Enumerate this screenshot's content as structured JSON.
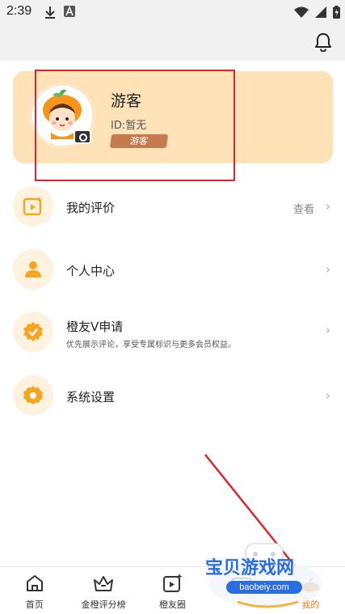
{
  "status_bar": {
    "time": "2:39"
  },
  "profile": {
    "name": "游客",
    "id_text": "ID:暂无",
    "badge": "游客"
  },
  "menu": {
    "items": [
      {
        "label": "我的评价",
        "action": "查看",
        "icon": "review-icon"
      },
      {
        "label": "个人中心",
        "icon": "person-icon"
      },
      {
        "label": "橙友V申请",
        "subtitle": "优先展示评论，享受专属标识与更多会员权益。",
        "icon": "verified-badge-icon"
      },
      {
        "label": "系统设置",
        "icon": "settings-gear-icon"
      }
    ],
    "chevron": "›"
  },
  "bottom_nav": {
    "items": [
      {
        "label": "首页",
        "icon": "home-icon"
      },
      {
        "label": "金橙评分榜",
        "icon": "crown-icon"
      },
      {
        "label": "橙友圈",
        "icon": "post-video-icon"
      },
      {
        "label": "",
        "icon": "game-controller-icon"
      },
      {
        "label": "我的",
        "icon": "profile-orange-icon",
        "active": true
      }
    ]
  },
  "watermark": {
    "title": "宝贝游戏网",
    "url": "baobeiy.com"
  },
  "colors": {
    "accent": "#e57b18",
    "card_bg": "#ffe2b7",
    "icon_bg": "#fff2de",
    "icon_fg": "#f6a521",
    "annotation_red": "#d8282e"
  }
}
